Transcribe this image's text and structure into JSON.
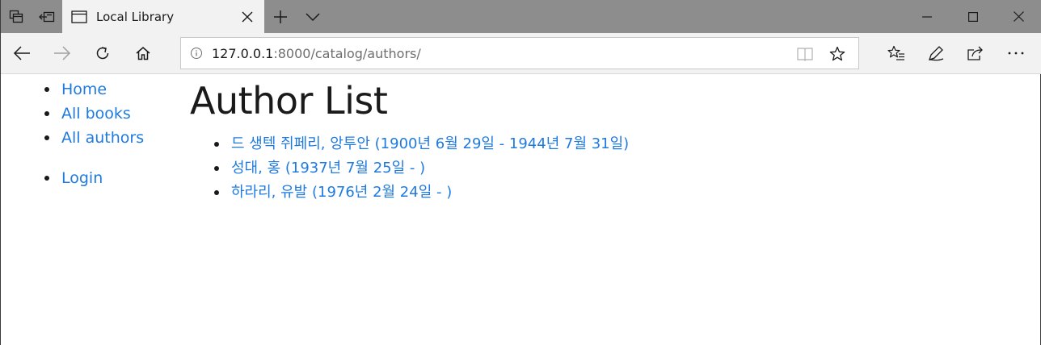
{
  "browser": {
    "tab_title": "Local Library",
    "address": {
      "host": "127.0.0.1",
      "path": ":8000/catalog/authors/"
    }
  },
  "sidebar": {
    "items": [
      {
        "label": "Home"
      },
      {
        "label": "All books"
      },
      {
        "label": "All authors"
      },
      {
        "label": "Login"
      }
    ]
  },
  "main": {
    "title": "Author List",
    "authors": [
      {
        "label": "드 생텍 쥐페리, 앙투안 (1900년 6월 29일 - 1944년 7월 31일)"
      },
      {
        "label": "성대, 홍 (1937년 7월 25일 - )"
      },
      {
        "label": "하라리, 유발 (1976년 2월 24일 - )"
      }
    ]
  },
  "colors": {
    "link": "#1f7ae0",
    "tabstrip": "#8d8d8d",
    "toolbar": "#f2f2f2"
  }
}
